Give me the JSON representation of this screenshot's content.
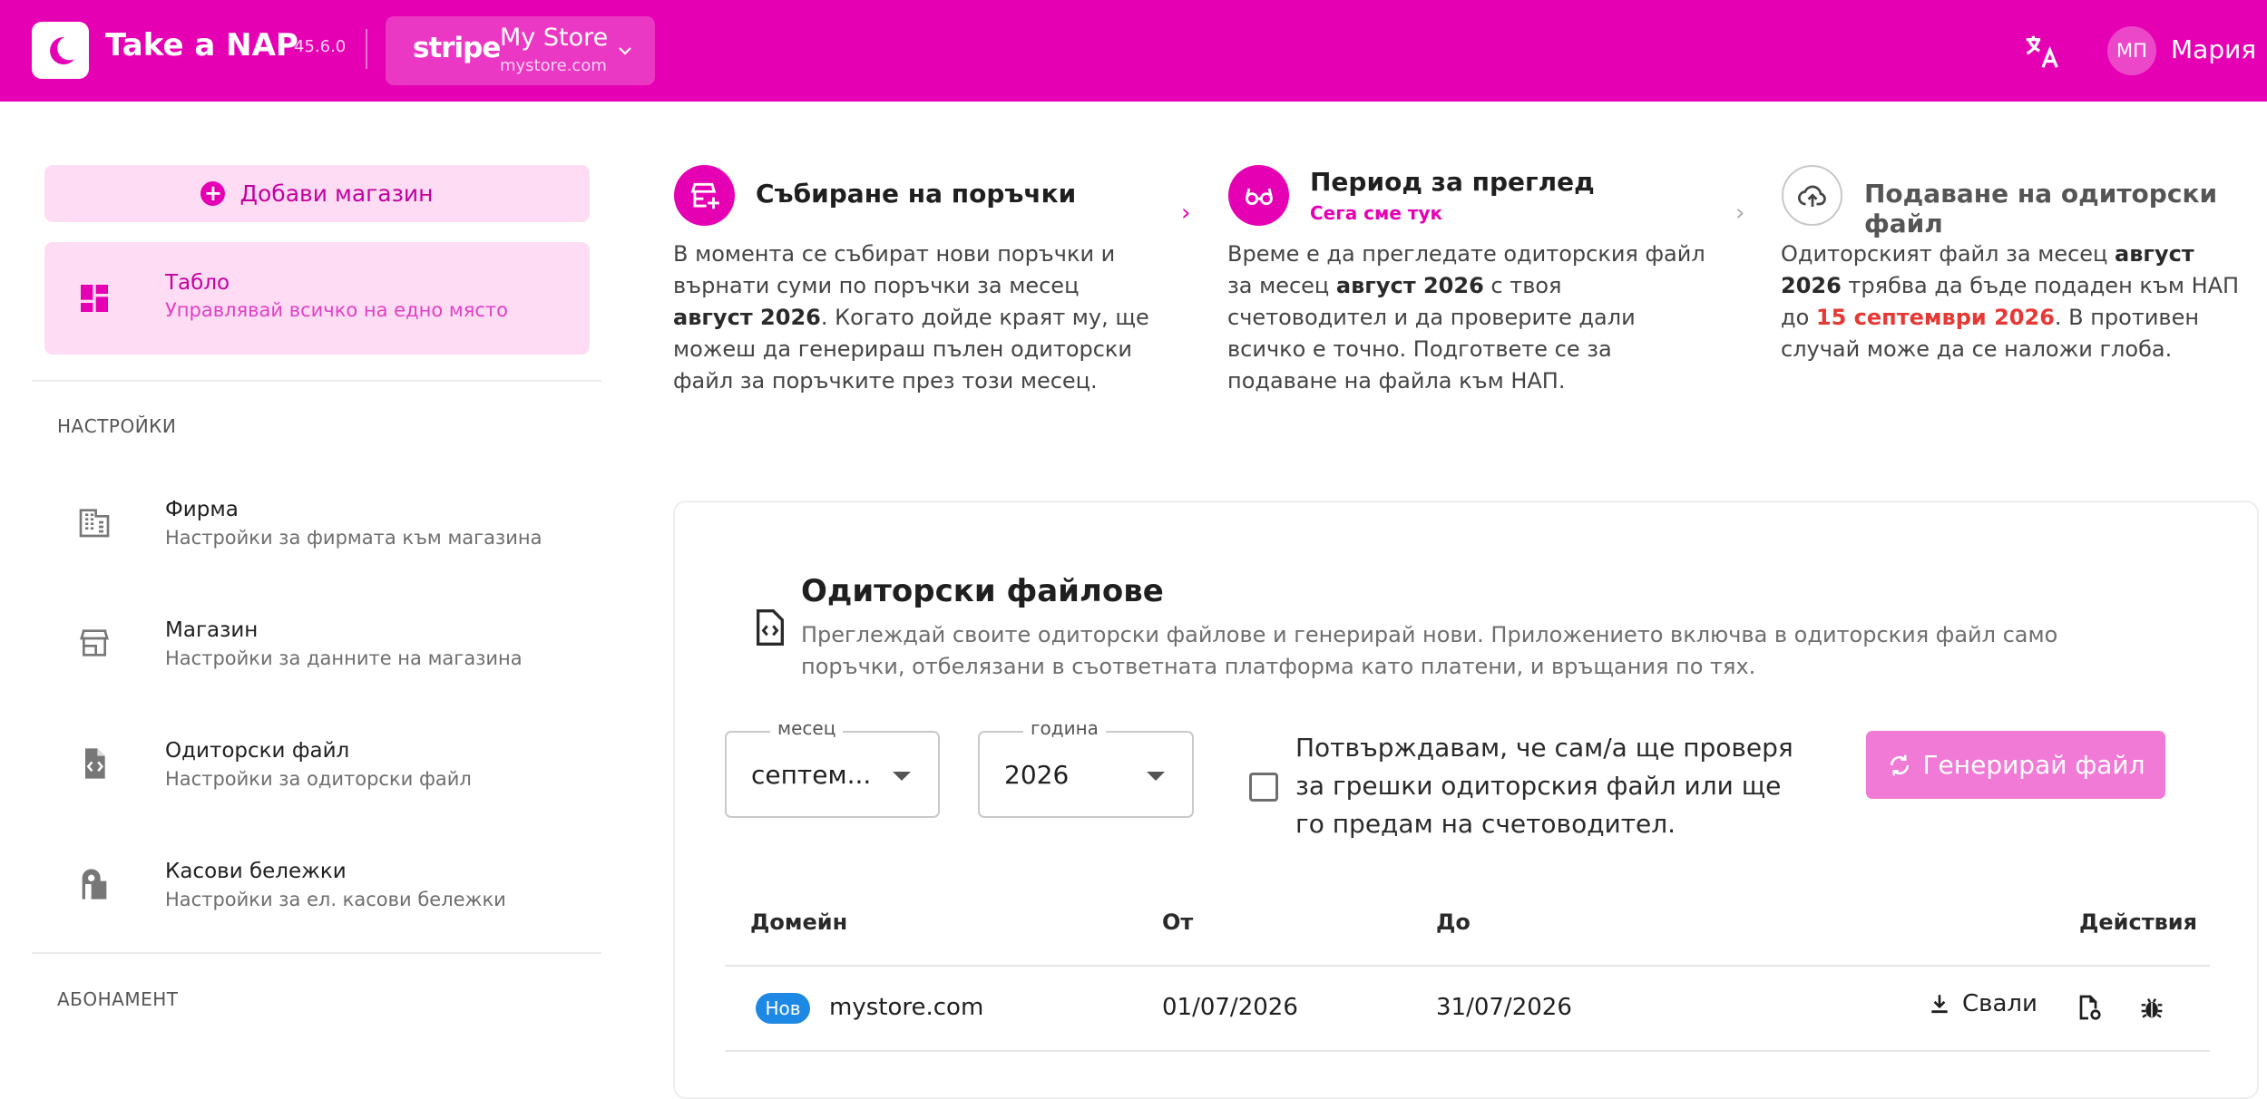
{
  "header": {
    "app_title": "Take a NAP",
    "version": "45.6.0",
    "store_switcher": {
      "platform": "stripe",
      "store_name": "My Store",
      "store_domain": "mystore.com"
    },
    "user": {
      "initials": "МП",
      "name": "Мария"
    }
  },
  "sidebar": {
    "add_store_label": "Добави магазин",
    "active_item": {
      "title": "Табло",
      "subtitle": "Управлявай всичко на едно място"
    },
    "settings_label": "НАСТРОЙКИ",
    "items": [
      {
        "title": "Фирма",
        "subtitle": "Настройки за фирмата към магазина",
        "icon": "building-icon"
      },
      {
        "title": "Магазин",
        "subtitle": "Настройки за данните на магазина",
        "icon": "store-icon"
      },
      {
        "title": "Одиторски файл",
        "subtitle": "Настройки за одиторски файл",
        "icon": "file-code-icon"
      },
      {
        "title": "Касови бележки",
        "subtitle": "Настройки за ел. касови бележки",
        "icon": "receipt-printer-icon"
      }
    ],
    "subscription_label": "АБОНАМЕНТ"
  },
  "steps": [
    {
      "title": "Събиране на поръчки",
      "text_parts": [
        "В момента се събират нови поръчки и върнати суми по поръчки за месец ",
        "август 2026",
        ". Когато дойде краят му, ще можеш да генерираш пълен одиторски файл за поръчките през този месец."
      ]
    },
    {
      "title": "Период за преглед",
      "subtitle": "Сега сме тук",
      "text_parts": [
        "Време е да прегледате одиторския файл за месец ",
        "август 2026",
        " с твоя счетоводител и да проверите дали всичко е точно. Подгответе се за подаване на файла към НАП."
      ]
    },
    {
      "title": "Подаване на одиторски файл",
      "text_parts": [
        "Одиторският файл за месец ",
        "август 2026",
        " трябва да бъде подаден към НАП до ",
        "15 септември 2026",
        ". В противен случай може да се наложи глоба."
      ]
    }
  ],
  "audit": {
    "title": "Одиторски файлове",
    "description": "Преглеждай своите одиторски файлове и генерирай нови. Приложението включва в одиторския файл само поръчки, отбелязани в съответната платформа като платени, и връщания по тях.",
    "month_label": "месец",
    "month_value": "септем...",
    "year_label": "година",
    "year_value": "2026",
    "confirm_text": "Потвърждавам, че сам/а ще проверя за грешки одиторския файл или ще го предам на счетоводител.",
    "generate_label": "Генерирай файл",
    "columns": [
      "Домейн",
      "От",
      "До",
      "Действия"
    ],
    "rows": [
      {
        "badge": "Нов",
        "domain": "mystore.com",
        "from": "01/07/2026",
        "to": "31/07/2026",
        "download_label": "Свали"
      }
    ]
  },
  "colors": {
    "brand": "#e600b4",
    "brand_light": "#fddcf4",
    "badge_blue": "#1e88e5",
    "deadline_red": "#e53935"
  }
}
